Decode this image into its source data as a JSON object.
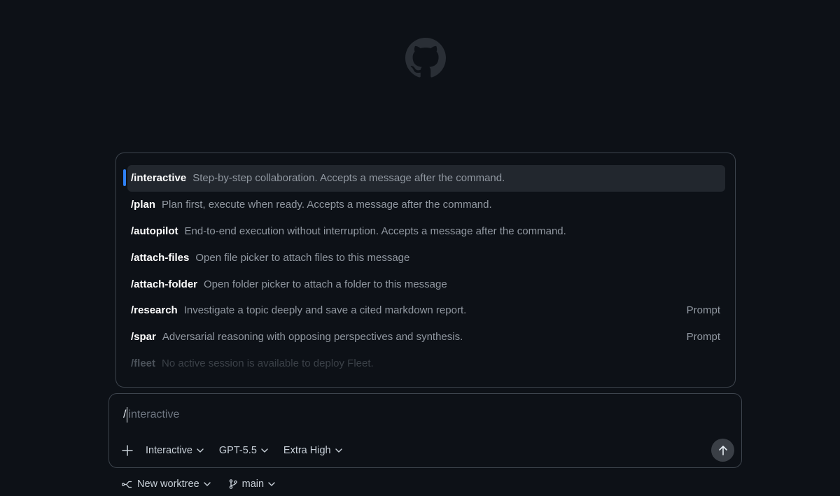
{
  "logo": {
    "icon": "github-icon",
    "color": "#2a2f36"
  },
  "slash_menu": {
    "items": [
      {
        "command": "/interactive",
        "description": "Step-by-step collaboration. Accepts a message after the command.",
        "tag": "",
        "state": "active"
      },
      {
        "command": "/plan",
        "description": "Plan first, execute when ready. Accepts a message after the command.",
        "tag": "",
        "state": "normal"
      },
      {
        "command": "/autopilot",
        "description": "End-to-end execution without interruption. Accepts a message after the command.",
        "tag": "",
        "state": "normal"
      },
      {
        "command": "/attach-files",
        "description": "Open file picker to attach files to this message",
        "tag": "",
        "state": "normal"
      },
      {
        "command": "/attach-folder",
        "description": "Open folder picker to attach a folder to this message",
        "tag": "",
        "state": "normal"
      },
      {
        "command": "/research",
        "description": "Investigate a topic deeply and save a cited markdown report.",
        "tag": "Prompt",
        "state": "normal"
      },
      {
        "command": "/spar",
        "description": "Adversarial reasoning with opposing perspectives and synthesis.",
        "tag": "Prompt",
        "state": "normal"
      },
      {
        "command": "/fleet",
        "description": "No active session is available to deploy Fleet.",
        "tag": "",
        "state": "disabled"
      }
    ],
    "accent_color": "#2f81f7"
  },
  "composer": {
    "typed": "/",
    "placeholder": "interactive",
    "mode_label": "Interactive",
    "model_label": "GPT-5.5",
    "effort_label": "Extra High",
    "add_icon": "plus-icon",
    "send_icon": "arrow-up-icon"
  },
  "footer": {
    "worktree_label": "New worktree",
    "branch_label": "main",
    "worktree_icon": "worktree-icon",
    "branch_icon": "git-branch-icon"
  }
}
